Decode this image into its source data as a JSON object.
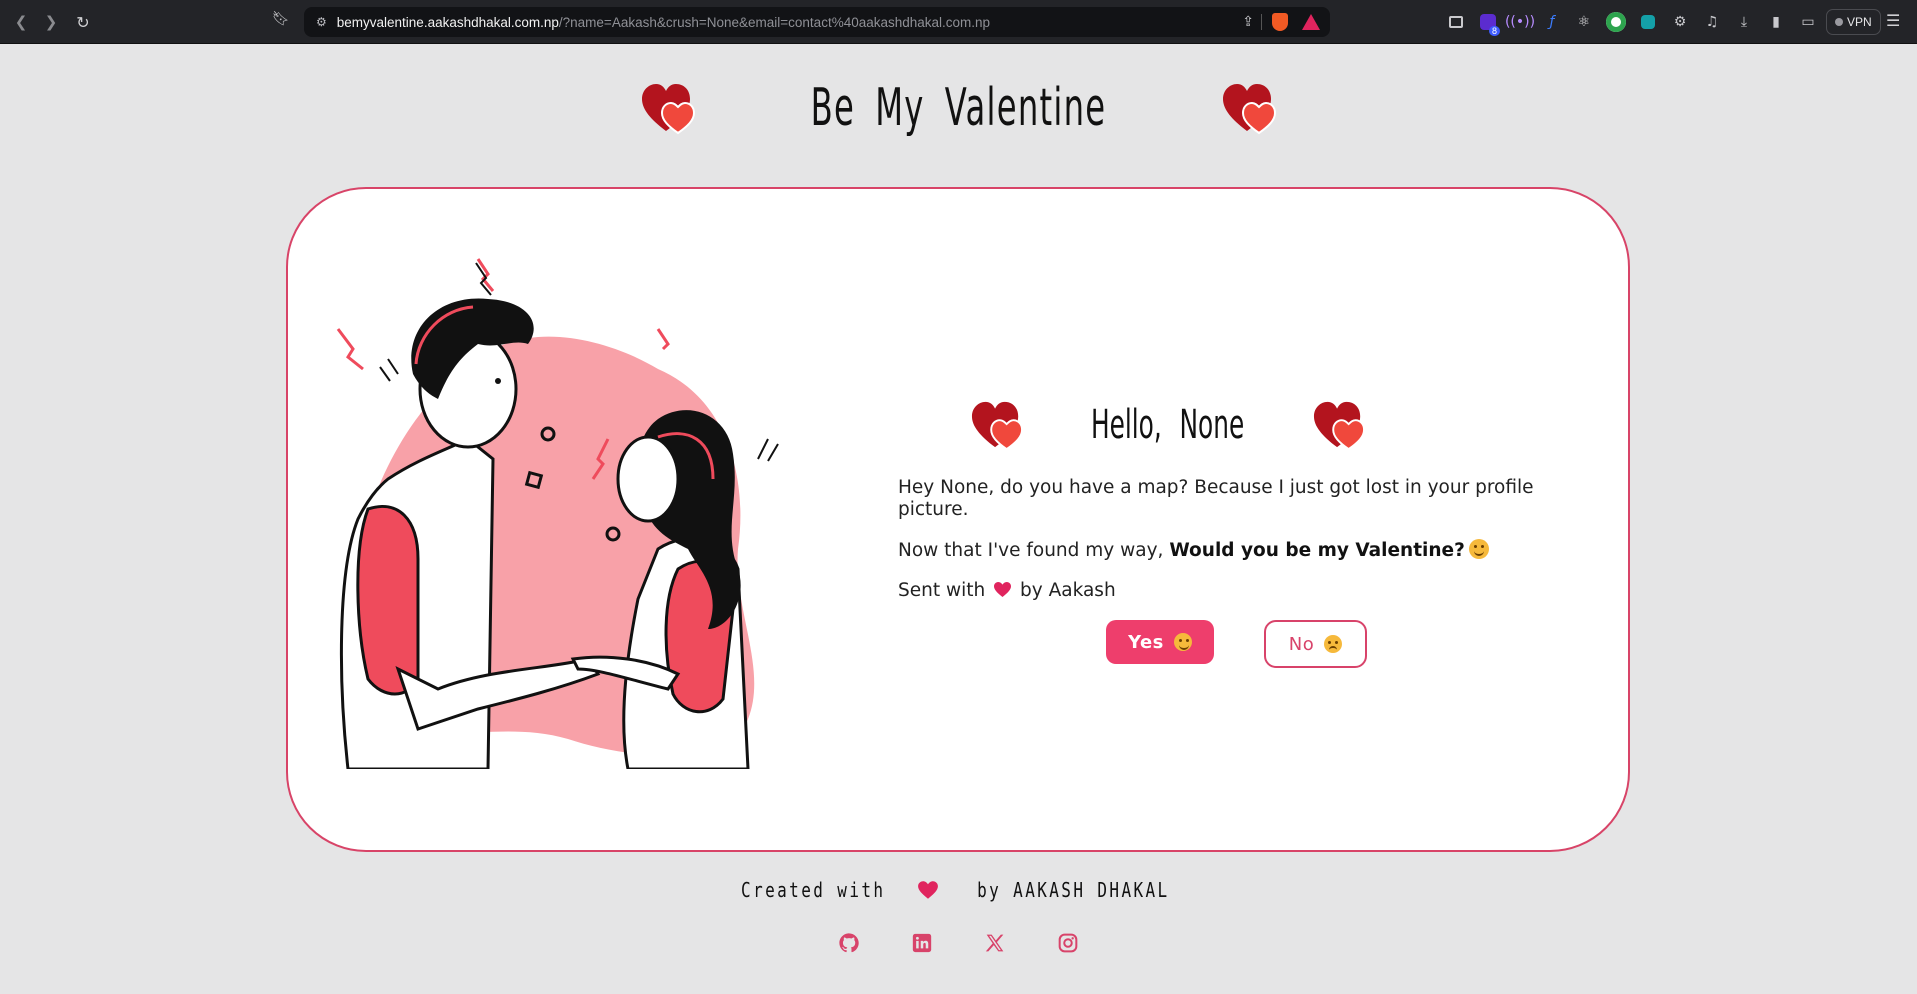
{
  "browser": {
    "url_host": "bemyvalentine.aakashdhakal.com.np",
    "url_path": "/?name=Aakash&crush=None&email=contact%40aakashdhakal.com.np",
    "vpn_label": "VPN",
    "extension_badge": "8",
    "icons": [
      "back-icon",
      "forward-icon",
      "reload-icon",
      "bookmark-icon",
      "site-settings-icon",
      "share-icon",
      "brave-shield-icon",
      "rewards-icon",
      "menu-icon"
    ]
  },
  "header": {
    "title": "Be My Valentine"
  },
  "card": {
    "greeting": "Hello, None",
    "line1": "Hey None, do you have a map? Because I just got lost in your profile picture.",
    "line2_prefix": "Now that I've found my way, ",
    "line2_bold": "Would you be my Valentine?",
    "line3_prefix": "Sent with",
    "line3_suffix": "by Aakash",
    "yes_label": "Yes",
    "no_label": "No"
  },
  "footer": {
    "created_prefix": "Created with",
    "created_suffix": "by AAKASH DHAKAL",
    "socials": [
      "github-icon",
      "linkedin-icon",
      "x-icon",
      "instagram-icon"
    ]
  },
  "colors": {
    "accent": "#ee3e6c",
    "card_border": "#d84468",
    "heart_dark": "#b3141e",
    "heart_light": "#f0483c",
    "background": "#e5e5e6",
    "illustration_blob": "#f8a1a8",
    "illustration_sleeve": "#ef4b5c"
  }
}
